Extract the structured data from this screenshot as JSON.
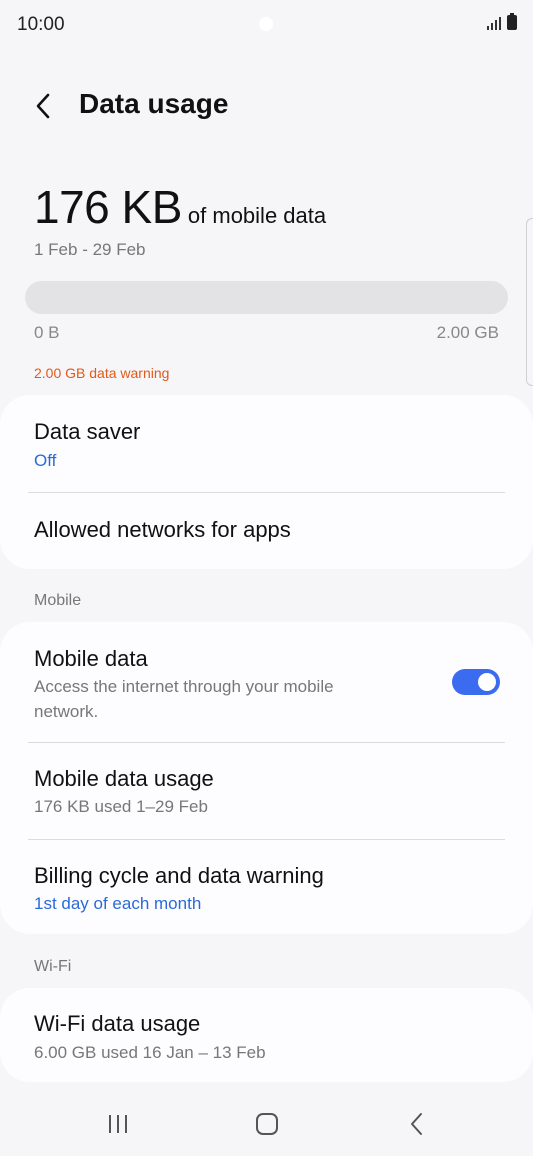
{
  "status_bar": {
    "time": "10:00"
  },
  "header": {
    "title": "Data usage"
  },
  "usage": {
    "amount": "176 KB",
    "suffix": "of mobile data",
    "period": "1 Feb - 29 Feb",
    "progress_fraction": 0.0,
    "range_min": "0 B",
    "range_max": "2.00 GB",
    "warning": "2.00 GB data warning"
  },
  "data_saver_card": {
    "data_saver": {
      "title": "Data saver",
      "status": "Off"
    },
    "allowed_networks": {
      "title": "Allowed networks for apps"
    }
  },
  "mobile_section": {
    "header": "Mobile",
    "mobile_data": {
      "title": "Mobile data",
      "subtitle_line1": "Access the internet through your mobile",
      "subtitle_line2": "network.",
      "enabled": true
    },
    "mobile_data_usage": {
      "title": "Mobile data usage",
      "subtitle": "176 KB used 1–29 Feb"
    },
    "billing_cycle": {
      "title": "Billing cycle and data warning",
      "subtitle": "1st day of each month"
    }
  },
  "wifi_section": {
    "header": "Wi-Fi",
    "wifi_data_usage": {
      "title": "Wi-Fi data usage",
      "subtitle": "6.00 GB used 16 Jan – 13 Feb"
    }
  },
  "colors": {
    "accent": "#3b6cf0",
    "link": "#2b6ad6",
    "warning": "#e05a1a",
    "background": "#f6f6f8",
    "card": "#fdfdff"
  },
  "icons": {
    "back": "chevron-left-icon",
    "nav_recents": "recents-icon",
    "nav_home": "home-icon",
    "nav_back": "back-icon"
  }
}
